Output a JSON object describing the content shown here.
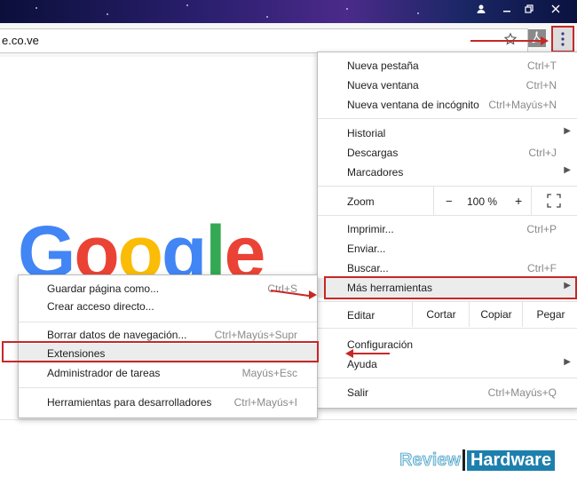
{
  "browser": {
    "url_text": "e.co.ve"
  },
  "menu": {
    "items": [
      {
        "label": "Nueva pestaña",
        "shortcut": "Ctrl+T"
      },
      {
        "label": "Nueva ventana",
        "shortcut": "Ctrl+N"
      },
      {
        "label": "Nueva ventana de incógnito",
        "shortcut": "Ctrl+Mayús+N"
      },
      {
        "label": "Historial"
      },
      {
        "label": "Descargas",
        "shortcut": "Ctrl+J"
      },
      {
        "label": "Marcadores"
      },
      {
        "label": "Imprimir...",
        "shortcut": "Ctrl+P"
      },
      {
        "label": "Enviar..."
      },
      {
        "label": "Buscar...",
        "shortcut": "Ctrl+F"
      },
      {
        "label": "Más herramientas"
      },
      {
        "label": "Configuración"
      },
      {
        "label": "Ayuda"
      },
      {
        "label": "Salir",
        "shortcut": "Ctrl+Mayús+Q"
      }
    ],
    "zoom": {
      "label": "Zoom",
      "minus": "−",
      "value": "100 %",
      "plus": "+"
    },
    "edit": {
      "label": "Editar",
      "cut": "Cortar",
      "copy": "Copiar",
      "paste": "Pegar"
    }
  },
  "submenu": {
    "items": [
      {
        "label": "Guardar página como...",
        "shortcut": "Ctrl+S"
      },
      {
        "label": "Crear acceso directo..."
      },
      {
        "label": "Borrar datos de navegación...",
        "shortcut": "Ctrl+Mayús+Supr"
      },
      {
        "label": "Extensiones"
      },
      {
        "label": "Administrador de tareas",
        "shortcut": "Mayús+Esc"
      },
      {
        "label": "Herramientas para desarrolladores",
        "shortcut": "Ctrl+Mayús+I"
      }
    ]
  },
  "logo": {
    "text": "Google"
  },
  "watermark": {
    "left": "Review",
    "right": "Hardware"
  },
  "colors": {
    "highlight": "#c62828",
    "google_blue": "#4285f4",
    "google_red": "#ea4335",
    "google_yellow": "#fbbc05",
    "google_green": "#34a853"
  }
}
